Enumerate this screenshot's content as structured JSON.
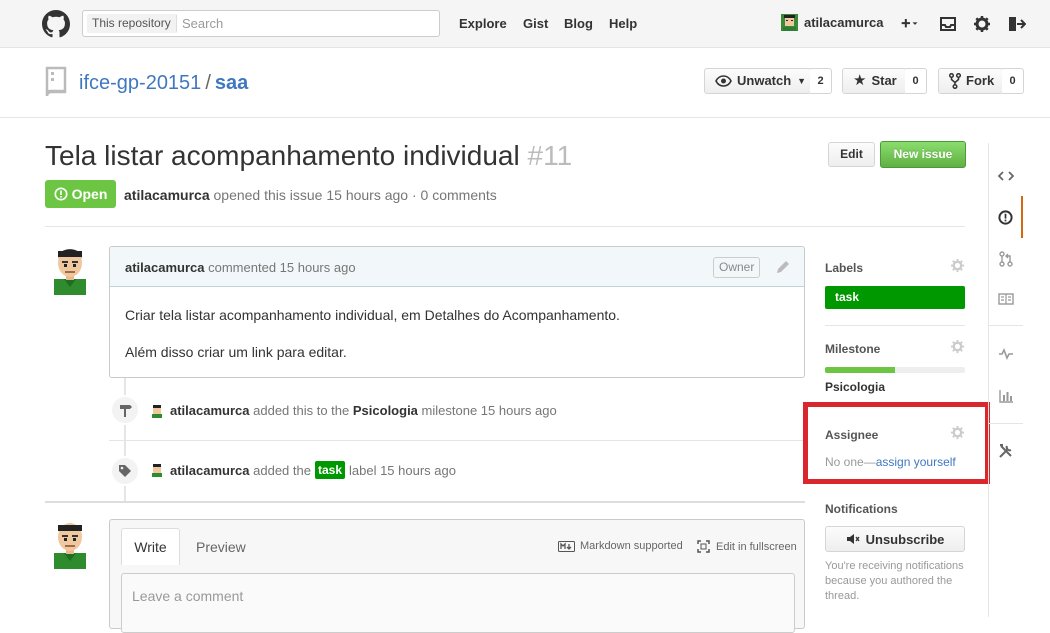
{
  "header": {
    "search_scope": "This repository",
    "search_placeholder": "Search",
    "nav": [
      "Explore",
      "Gist",
      "Blog",
      "Help"
    ],
    "username": "atilacamurca"
  },
  "repo": {
    "owner": "ifce-gp-20151",
    "separator": "/",
    "name": "saa",
    "unwatch_label": "Unwatch",
    "unwatch_count": "2",
    "star_label": "Star",
    "star_count": "0",
    "fork_label": "Fork",
    "fork_count": "0"
  },
  "issue": {
    "title": "Tela listar acompanhamento individual",
    "number": "#11",
    "state": "Open",
    "author": "atilacamurca",
    "opened_text": "opened this issue 15 hours ago · 0 comments",
    "edit_label": "Edit",
    "new_issue_label": "New issue"
  },
  "comment": {
    "author": "atilacamurca",
    "time": "commented 15 hours ago",
    "owner_badge": "Owner",
    "paragraphs": [
      "Criar tela listar acompanhamento individual, em Detalhes do Acompanhamento.",
      "Além disso criar um link para editar."
    ]
  },
  "timeline": [
    {
      "user": "atilacamurca",
      "pre": "added this to the",
      "target": "Psicologia",
      "post": "milestone 15 hours ago"
    },
    {
      "user": "atilacamurca",
      "pre": "added the",
      "target": "task",
      "post": "label 15 hours ago"
    }
  ],
  "form": {
    "tab_write": "Write",
    "tab_preview": "Preview",
    "markdown_note": "Markdown supported",
    "fullscreen_note": "Edit in fullscreen",
    "placeholder": "Leave a comment"
  },
  "sidebar": {
    "labels_title": "Labels",
    "label_task": "task",
    "label_color": "#009800",
    "milestone_title": "Milestone",
    "milestone_progress": 0.5,
    "milestone_name": "Psicologia",
    "assignee_title": "Assignee",
    "assignee_none": "No one—",
    "assign_yourself": "assign yourself",
    "notifications_title": "Notifications",
    "unsubscribe_label": "Unsubscribe",
    "notifications_text": "You're receiving notifications because you authored the thread."
  },
  "colors": {
    "accent_link": "#4078c0",
    "open_green": "#6cc644",
    "highlight_red": "#d9272d"
  }
}
